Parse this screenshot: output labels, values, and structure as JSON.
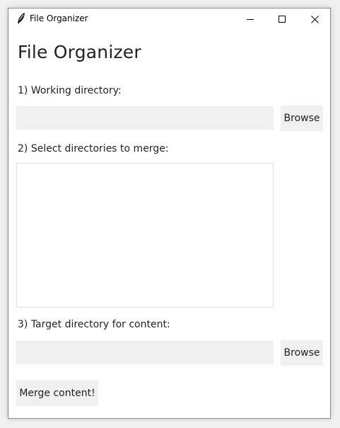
{
  "window": {
    "title": "File Organizer"
  },
  "main": {
    "heading": "File Organizer",
    "step1_label": "1) Working directory:",
    "step1_value": "",
    "step1_browse": "Browse",
    "step2_label": "2) Select directories to merge:",
    "step2_items": [],
    "step3_label": "3) Target directory for content:",
    "step3_value": "",
    "step3_browse": "Browse",
    "merge_button": "Merge content!"
  },
  "icons": {
    "app": "feather-icon",
    "minimize": "minimize-icon",
    "maximize": "maximize-icon",
    "close": "close-icon"
  }
}
